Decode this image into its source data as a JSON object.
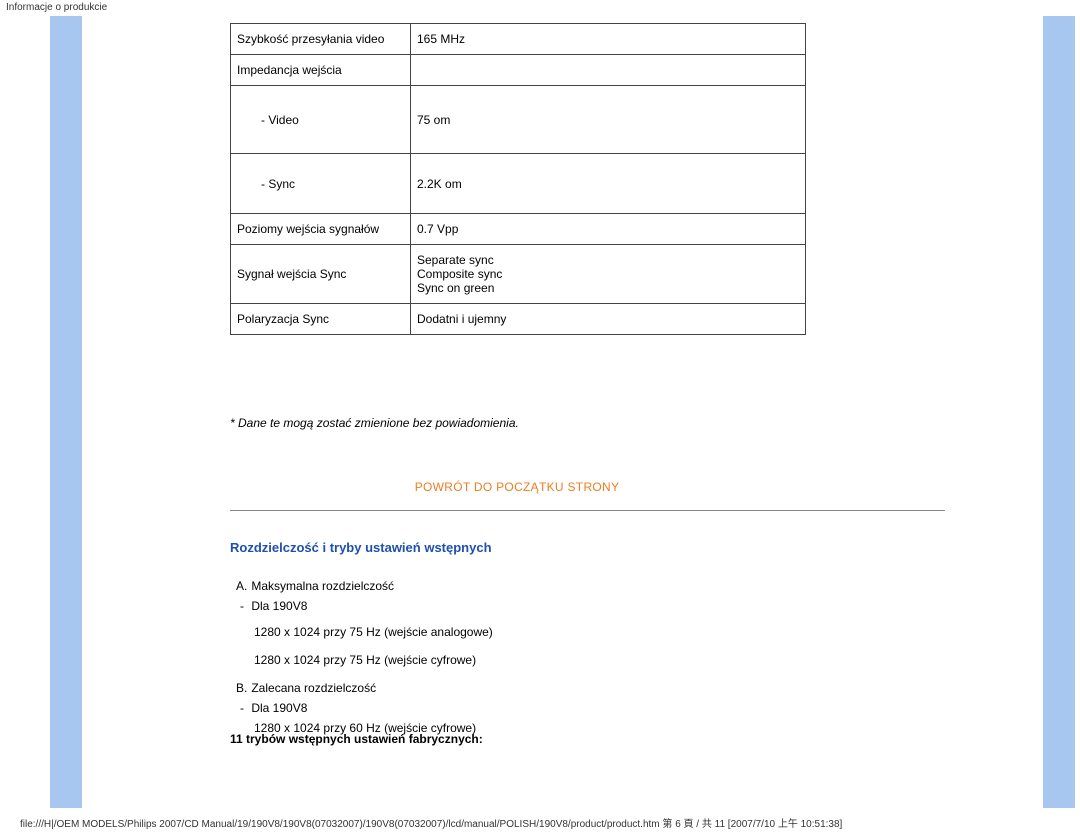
{
  "page_header": "Informacje o produkcie",
  "page_footer": "file:///H|/OEM MODELS/Philips 2007/CD Manual/19/190V8/190V8(07032007)/190V8(07032007)/lcd/manual/POLISH/190V8/product/product.htm 第 6 頁 / 共 11  [2007/7/10 上午 10:51:38]",
  "table": {
    "rows": [
      {
        "label": "Szybkość przesyłania video",
        "value": "165 MHz"
      },
      {
        "label": "Impedancja wejścia",
        "value": ""
      },
      {
        "label": "　　- Video",
        "value": "75 om"
      },
      {
        "label": "　　- Sync",
        "value": "2.2K om"
      },
      {
        "label": "Poziomy wejścia sygnałów",
        "value": "0.7 Vpp"
      },
      {
        "label": "Sygnał wejścia Sync",
        "value": "Separate sync\nComposite sync\nSync on green"
      },
      {
        "label": "Polaryzacja Sync",
        "value": "Dodatni i ujemny"
      }
    ]
  },
  "disclaimer": "* Dane te mogą zostać zmienione bez powiadomienia.",
  "back_to_top": "POWRÓT DO POCZĄTKU STRONY",
  "section_heading": "Rozdzielczość i tryby ustawień wstępnych",
  "resolution": {
    "a_label": "A.",
    "a_text": "Maksymalna rozdzielczość",
    "a_dash": "-",
    "a_model": "Dla 190V8",
    "a_line1": "1280 x 1024 przy 75 Hz (wejście analogowe)",
    "a_line2": "1280 x 1024 przy 75 Hz (wejście cyfrowe)",
    "b_label": "B.",
    "b_text": "Zalecana rozdzielczość",
    "b_dash": "-",
    "b_model": "Dla 190V8",
    "b_line1": "1280 x 1024 przy 60 Hz (wejście cyfrowe)"
  },
  "factory_presets_heading": "11 trybów wstępnych ustawień fabrycznych:"
}
